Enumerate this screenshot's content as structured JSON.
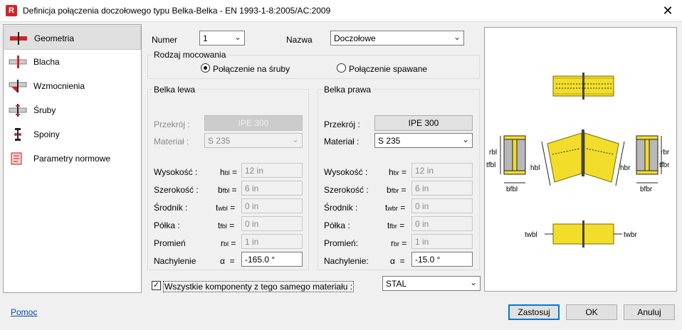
{
  "window": {
    "title": "Definicja połączenia doczołowego typu Belka-Belka - EN 1993-1-8:2005/AC:2009",
    "app_icon": "R",
    "close": "✕"
  },
  "nav": {
    "items": [
      {
        "label": "Geometria",
        "icon": "geometry-icon"
      },
      {
        "label": "Blacha",
        "icon": "plate-icon"
      },
      {
        "label": "Wzmocnienia",
        "icon": "stiffener-icon"
      },
      {
        "label": "Śruby",
        "icon": "bolt-icon"
      },
      {
        "label": "Spoiny",
        "icon": "weld-icon"
      },
      {
        "label": "Parametry normowe",
        "icon": "code-params-icon"
      }
    ]
  },
  "header": {
    "numer_label": "Numer",
    "numer_value": "1",
    "nazwa_label": "Nazwa",
    "nazwa_value": "Doczołowe"
  },
  "mounting": {
    "legend": "Rodzaj mocowania",
    "bolted": "Połączenie na śruby",
    "welded": "Połączenie spawane",
    "selected": "bolted"
  },
  "left": {
    "legend": "Belka lewa",
    "przekroj_label": "Przekrój :",
    "przekroj_value": "IPE 300",
    "material_label": "Materiał :",
    "material_value": "S 235",
    "rows": [
      {
        "label": "Wysokość :",
        "sym": "h",
        "sub": "bl",
        "eq": "=",
        "value": "12 in"
      },
      {
        "label": "Szerokość :",
        "sym": "b",
        "sub": "fbl",
        "eq": "=",
        "value": "6 in"
      },
      {
        "label": "Środnik :",
        "sym": "t",
        "sub": "wbl",
        "eq": "=",
        "value": "0 in"
      },
      {
        "label": "Półka :",
        "sym": "t",
        "sub": "fbl",
        "eq": "=",
        "value": "0 in"
      },
      {
        "label": "Promień",
        "sym": "r",
        "sub": "bl",
        "eq": "=",
        "value": "1 in"
      }
    ],
    "slope_label": "Nachylenie",
    "slope_sym": "α",
    "slope_eq": "=",
    "slope_value": "-165.0 °"
  },
  "right": {
    "legend": "Belka prawa",
    "przekroj_label": "Przekrój :",
    "przekroj_value": "IPE 300",
    "material_label": "Materiał :",
    "material_value": "S 235",
    "rows": [
      {
        "label": "Wysokość :",
        "sym": "h",
        "sub": "br",
        "eq": "=",
        "value": "12 in"
      },
      {
        "label": "Szerokość :",
        "sym": "b",
        "sub": "fbr",
        "eq": "=",
        "value": "6 in"
      },
      {
        "label": "Środnik :",
        "sym": "t",
        "sub": "wbr",
        "eq": "=",
        "value": "0 in"
      },
      {
        "label": "Półka :",
        "sym": "t",
        "sub": "fbr",
        "eq": "=",
        "value": "0 in"
      },
      {
        "label": "Promień:",
        "sym": "r",
        "sub": "br",
        "eq": "=",
        "value": "1 in"
      }
    ],
    "slope_label": "Nachylenie:",
    "slope_sym": "α",
    "slope_eq": "=",
    "slope_value": "-15.0 °"
  },
  "same_material": {
    "label": "Wszystkie komponenty z tego samego materiału :",
    "checked": true,
    "check_glyph": "✓",
    "value": "STAL"
  },
  "preview": {
    "labels": {
      "rbl": "rbl",
      "tfbl": "tfbl",
      "hbl": "hbl",
      "bfbl": "bfbl",
      "hbr": "hbr",
      "rbr": "rbr",
      "tfbr": "tfbr",
      "bfbr": "bfbr",
      "twbl": "twbl",
      "twbr": "twbr"
    },
    "colors": {
      "beam": "#f2dd2a",
      "beam_edge": "#7a6a00",
      "plate": "#8a8a8a",
      "section": "#b8b8b8"
    }
  },
  "footer": {
    "help": "Pomoc",
    "apply": "Zastosuj",
    "ok": "OK",
    "cancel": "Anuluj"
  }
}
